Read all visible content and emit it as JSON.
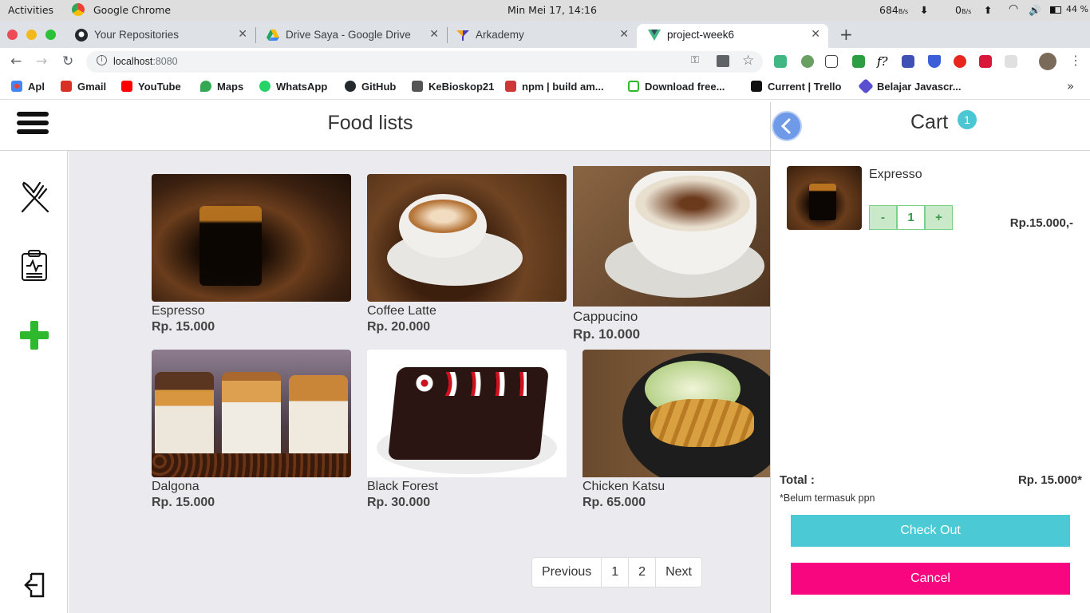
{
  "system_bar": {
    "activities": "Activities",
    "app": "Google Chrome",
    "clock": "Min Mei 17, 14:16",
    "net_down": "684",
    "net_down_unit": "B/s",
    "net_up": "0",
    "net_up_unit": "B/s",
    "battery": "44 %"
  },
  "tabs": [
    {
      "label": "Your Repositories",
      "icon": "github-icon"
    },
    {
      "label": "Drive Saya - Google Drive",
      "icon": "google-drive-icon"
    },
    {
      "label": "Arkademy",
      "icon": "arkademy-icon"
    },
    {
      "label": "project-week6",
      "icon": "vue-icon",
      "active": true
    }
  ],
  "address": {
    "host": "localhost",
    "port": ":8080"
  },
  "bookmarks": [
    {
      "label": "Apl",
      "color": "#4285f4"
    },
    {
      "label": "Gmail",
      "color": "#d93025"
    },
    {
      "label": "YouTube",
      "color": "#ff0000"
    },
    {
      "label": "Maps",
      "color": "#34a853"
    },
    {
      "label": "WhatsApp",
      "color": "#25d366"
    },
    {
      "label": "GitHub",
      "color": "#24292e"
    },
    {
      "label": "KeBioskop21",
      "color": "#555555"
    },
    {
      "label": "npm | build am...",
      "color": "#cb3837"
    },
    {
      "label": "Download free...",
      "color": "#2eb82e"
    },
    {
      "label": "Current | Trello",
      "color": "#111111"
    },
    {
      "label": "Belajar Javascr...",
      "color": "#5a4fcf"
    }
  ],
  "header": {
    "title": "Food lists"
  },
  "foods": [
    {
      "name": "Espresso",
      "price": "Rp. 15.000",
      "theme": "espresso"
    },
    {
      "name": "Coffee Latte",
      "price": "Rp. 20.000",
      "theme": "latte"
    },
    {
      "name": "Cappucino",
      "price": "Rp. 10.000",
      "theme": "cappucino"
    },
    {
      "name": "Dalgona",
      "price": "Rp. 15.000",
      "theme": "dalgona"
    },
    {
      "name": "Black Forest",
      "price": "Rp. 30.000",
      "theme": "cake"
    },
    {
      "name": "Chicken Katsu",
      "price": "Rp. 65.000",
      "theme": "katsu"
    }
  ],
  "pagination": {
    "prev": "Previous",
    "pages": [
      "1",
      "2"
    ],
    "next": "Next"
  },
  "cart": {
    "title": "Cart",
    "count": "1",
    "items": [
      {
        "name": "Expresso",
        "qty": "1",
        "minus": "-",
        "plus": "+",
        "price": "Rp.15.000,-"
      }
    ],
    "total_label": "Total :",
    "total_value": "Rp. 15.000*",
    "note": "*Belum termasuk ppn",
    "checkout": "Check Out",
    "cancel": "Cancel",
    "checkout_color": "#4bc9d4",
    "cancel_color": "#f7067f"
  }
}
